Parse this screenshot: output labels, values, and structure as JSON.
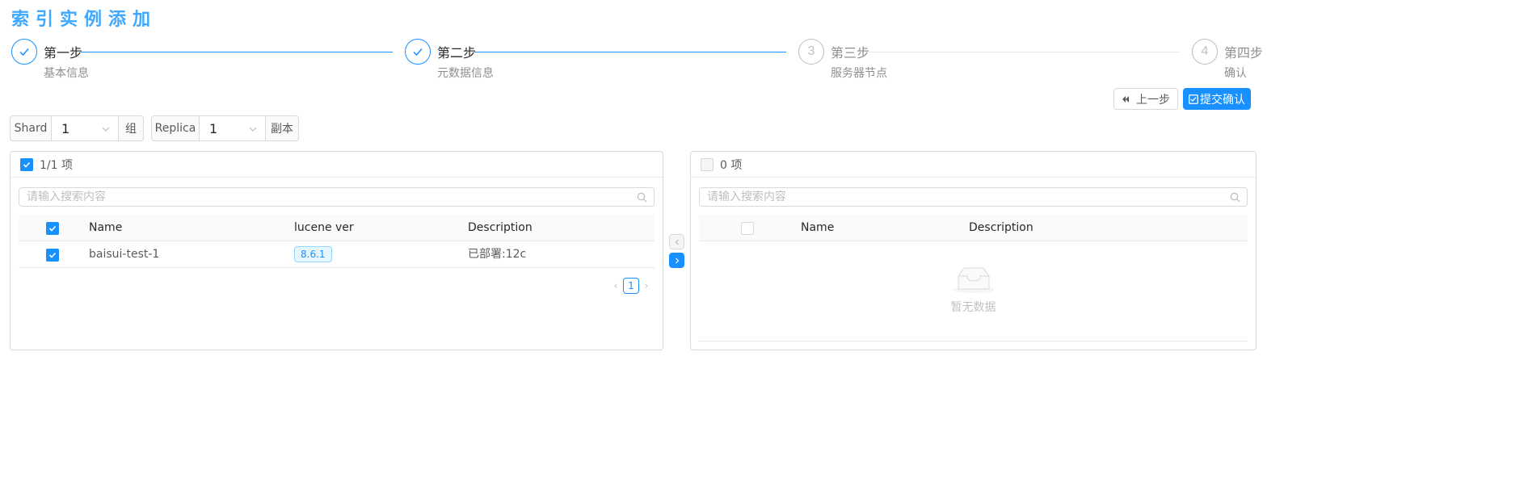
{
  "page": {
    "title": "索引实例添加"
  },
  "steps": [
    {
      "title": "第一步",
      "desc": "基本信息",
      "status": "finish",
      "icon": "check-icon"
    },
    {
      "title": "第二步",
      "desc": "元数据信息",
      "status": "finish",
      "icon": "check-icon"
    },
    {
      "title": "第三步",
      "desc": "服务器节点",
      "status": "wait",
      "number": "3"
    },
    {
      "title": "第四步",
      "desc": "确认",
      "status": "wait",
      "number": "4"
    }
  ],
  "actions": {
    "prev_label": "上一步",
    "submit_label": "提交确认"
  },
  "shard": {
    "label": "Shard",
    "value": "1",
    "suffix": "组"
  },
  "replica": {
    "label": "Replica",
    "value": "1",
    "suffix": "副本"
  },
  "left_panel": {
    "count": "1/1 项",
    "search_placeholder": "请输入搜索内容",
    "columns": [
      "Name",
      "lucene ver",
      "Description"
    ],
    "rows": [
      {
        "name": "baisui-test-1",
        "lucene_ver": "8.6.1",
        "description": "已部署:12c",
        "checked": true
      }
    ],
    "page": "1"
  },
  "right_panel": {
    "count": "0 项",
    "search_placeholder": "请输入搜索内容",
    "columns": [
      "Name",
      "Description"
    ],
    "empty_text": "暂无数据"
  },
  "colors": {
    "primary": "#1890ff",
    "title": "#40a9ff"
  }
}
